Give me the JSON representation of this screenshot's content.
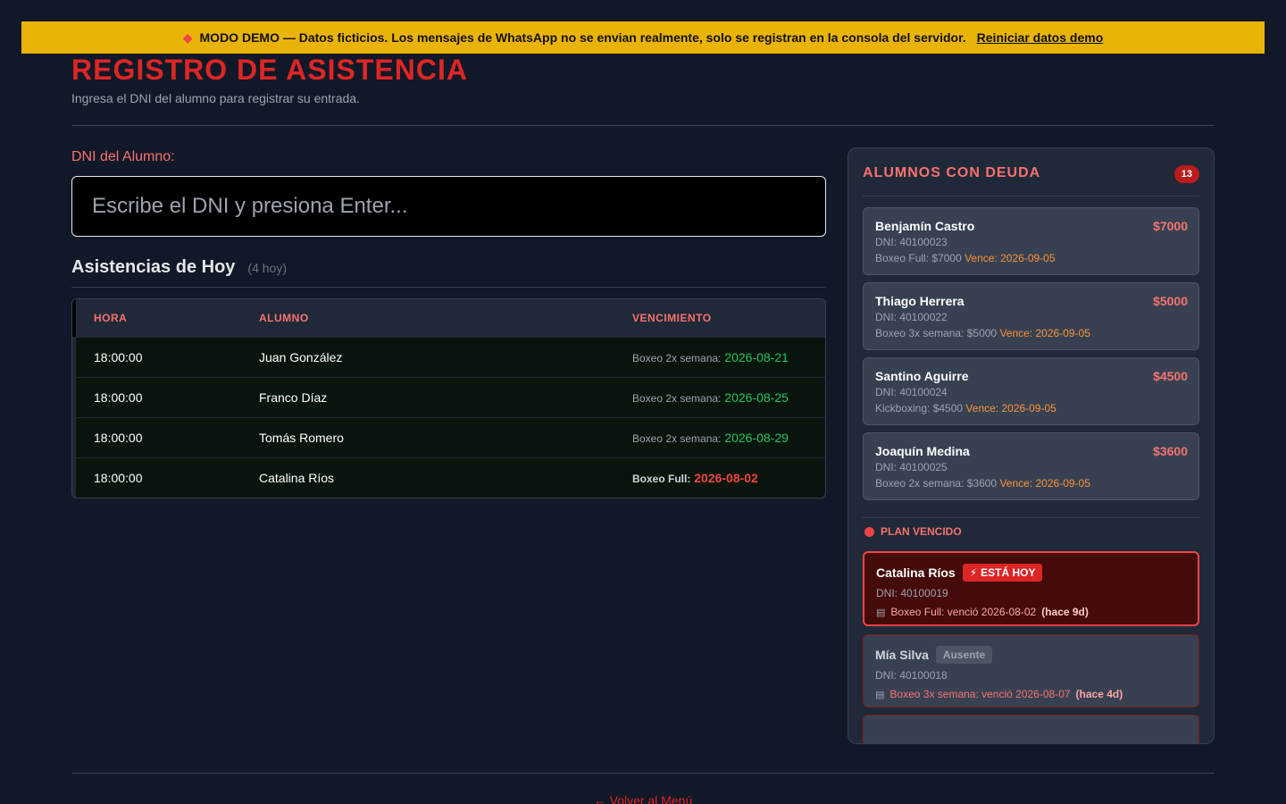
{
  "banner": {
    "icon": "diamond-icon",
    "text": "MODO DEMO — Datos ficticios. Los mensajes de WhatsApp no se envian realmente, solo se registran en la consola del servidor.",
    "link": "Reiniciar datos demo"
  },
  "header": {
    "title": "REGISTRO DE ASISTENCIA",
    "subtitle": "Ingresa el DNI del alumno para registrar su entrada."
  },
  "dni": {
    "label": "DNI del Alumno:",
    "placeholder": "Escribe el DNI y presiona Enter..."
  },
  "attendance": {
    "title": "Asistencias de Hoy",
    "count": "(4 hoy)",
    "columns": [
      "HORA",
      "ALUMNO",
      "VENCIMIENTO"
    ],
    "rows": [
      {
        "hora": "18:00:00",
        "alumno": "Juan González",
        "plan": "Boxeo 2x semana:",
        "fecha": "2026-08-21"
      },
      {
        "hora": "18:00:00",
        "alumno": "Franco Díaz",
        "plan": "Boxeo 2x semana:",
        "fecha": "2026-08-25"
      },
      {
        "hora": "18:00:00",
        "alumno": "Tomás Romero",
        "plan": "Boxeo 2x semana:",
        "fecha": "2026-08-29"
      },
      {
        "hora": "18:00:00",
        "alumno": "Catalina Ríos",
        "plan": "Boxeo Full:",
        "fecha": "2026-08-02"
      }
    ]
  },
  "debt": {
    "title": "ALUMNOS CON DEUDA",
    "count": "13",
    "vence_label": "Vence:",
    "cards": [
      {
        "name": "Benjamín Castro",
        "amount": "$7000",
        "dni": "DNI: 40100023",
        "plan": "Boxeo Full: $7000",
        "vence": "2026-09-05"
      },
      {
        "name": "Thiago Herrera",
        "amount": "$5000",
        "dni": "DNI: 40100022",
        "plan": "Boxeo 3x semana: $5000",
        "vence": "2026-09-05"
      },
      {
        "name": "Santino Aguirre",
        "amount": "$4500",
        "dni": "DNI: 40100024",
        "plan": "Kickboxing: $4500",
        "vence": "2026-09-05"
      },
      {
        "name": "Joaquín Medina",
        "amount": "$3600",
        "dni": "DNI: 40100025",
        "plan": "Boxeo 2x semana: $3600",
        "vence": "2026-09-05"
      }
    ]
  },
  "expired": {
    "title": "PLAN VENCIDO",
    "cards": [
      {
        "name": "Catalina Ríos",
        "badge": "ESTÁ HOY",
        "dni": "DNI: 40100019",
        "info": "Boxeo Full: venció 2026-08-02",
        "ago": "(hace 9d)"
      },
      {
        "name": "Mía Silva",
        "badge": "Ausente",
        "dni": "DNI: 40100018",
        "info": "Boxeo 3x semana: venció 2026-08-07",
        "ago": "(hace 4d)"
      }
    ]
  },
  "footer": {
    "back": "← Volver al Menú"
  },
  "colors": {
    "accent": "#dc2626",
    "banner": "#eab308",
    "ok": "#22c55e",
    "warn": "#fb923c"
  }
}
